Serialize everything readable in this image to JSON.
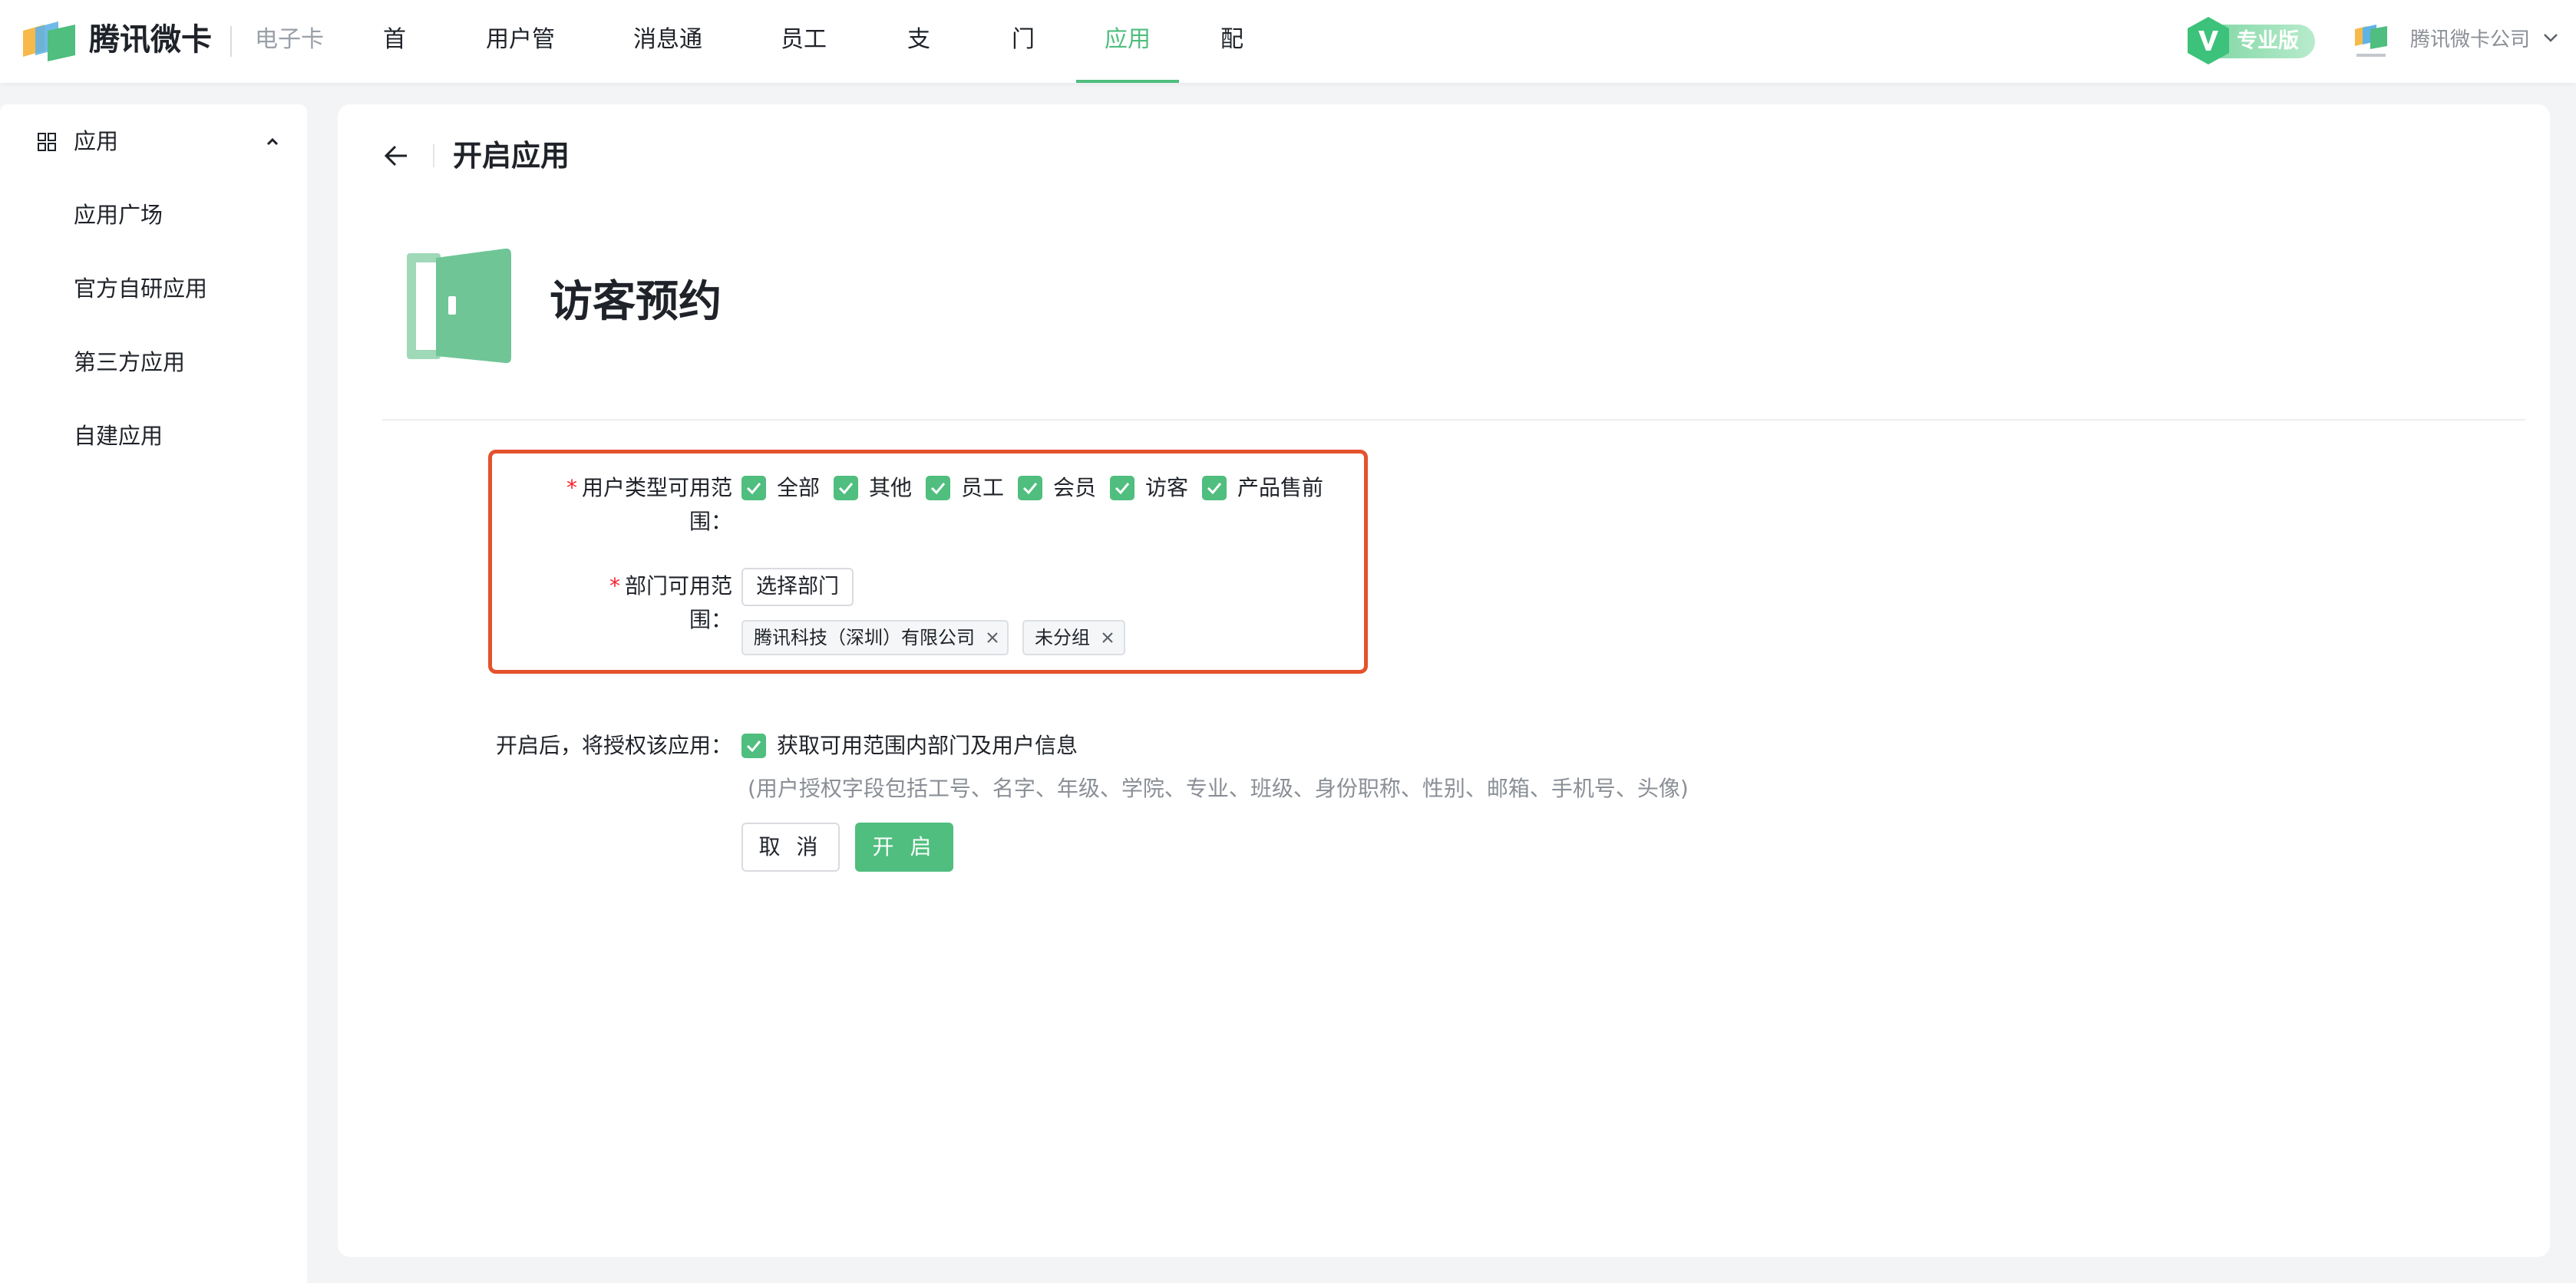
{
  "header": {
    "brand": "腾讯微卡",
    "product": "电子卡",
    "nav": [
      {
        "label": "首页"
      },
      {
        "label": "用户管理"
      },
      {
        "label": "消息通知"
      },
      {
        "label": "员工卡"
      },
      {
        "label": "支付"
      },
      {
        "label": "门禁"
      },
      {
        "label": "应用",
        "active": true
      },
      {
        "label": "配置"
      }
    ],
    "pro_badge": "专业版",
    "org_name": "腾讯微卡公司"
  },
  "sidebar": {
    "group_label": "应用",
    "items": [
      {
        "label": "应用广场"
      },
      {
        "label": "官方自研应用"
      },
      {
        "label": "第三方应用"
      },
      {
        "label": "自建应用"
      }
    ]
  },
  "main": {
    "page_title": "开启应用",
    "app_name": "访客预约",
    "user_type": {
      "label": "用户类型可用范围：",
      "options": [
        {
          "label": "全部",
          "checked": true
        },
        {
          "label": "其他",
          "checked": true
        },
        {
          "label": "员工",
          "checked": true
        },
        {
          "label": "会员",
          "checked": true
        },
        {
          "label": "访客",
          "checked": true
        },
        {
          "label": "产品售前",
          "checked": true
        }
      ]
    },
    "department": {
      "label": "部门可用范围：",
      "select_button": "选择部门",
      "tags": [
        "腾讯科技（深圳）有限公司",
        "未分组"
      ]
    },
    "authorize": {
      "label": "开启后，将授权该应用：",
      "option": "获取可用范围内部门及用户信息",
      "checked": true,
      "hint": "(用户授权字段包括工号、名字、年级、学院、专业、班级、身份职称、性别、邮箱、手机号、头像)"
    },
    "cancel_button": "取 消",
    "confirm_button": "开 启"
  },
  "colors": {
    "accent": "#4fbe7e",
    "highlight_border": "#e3522c",
    "required": "#f5222d"
  }
}
